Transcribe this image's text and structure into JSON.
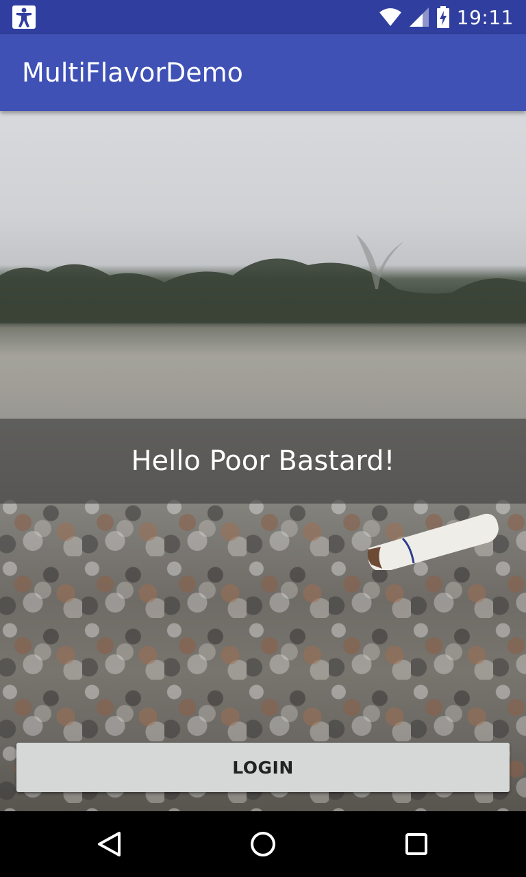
{
  "status_bar": {
    "time": "19:11",
    "icons": [
      "accessibility-icon",
      "wifi-icon",
      "signal-icon",
      "battery-charging-icon"
    ]
  },
  "app_bar": {
    "title": "MultiFlavorDemo",
    "color": "#3f51b5",
    "status_color": "#303f9f"
  },
  "main": {
    "greeting": "Hello Poor Bastard!",
    "login_label": "LOGIN"
  },
  "nav_bar": {
    "buttons": [
      "back-icon",
      "home-icon",
      "recents-icon"
    ]
  }
}
